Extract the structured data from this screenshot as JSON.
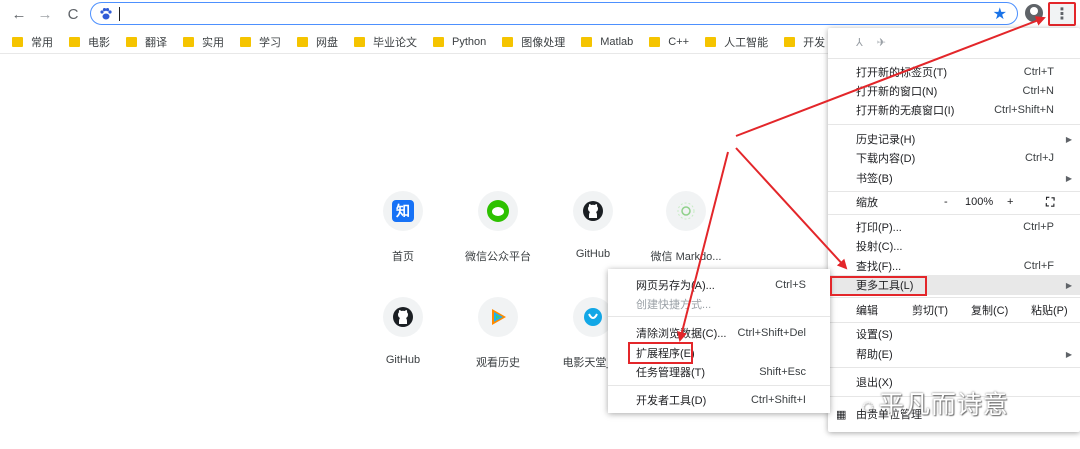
{
  "toolbar": {
    "back_icon": "arrow-left",
    "forward_icon": "arrow-right",
    "reload_icon": "reload",
    "address_value": "",
    "bookmark_star_icon": "star",
    "profile_icon": "account-circle",
    "menu_icon": "kebab-menu"
  },
  "bookmarks": [
    "常用",
    "电影",
    "翻译",
    "实用",
    "学习",
    "网盘",
    "毕业论文",
    "Python",
    "图像处理",
    "Matlab",
    "C++",
    "人工智能",
    "开发"
  ],
  "tiles": [
    {
      "label": "首页",
      "icon": "zhihu"
    },
    {
      "label": "微信公众平台",
      "icon": "wechat"
    },
    {
      "label": "GitHub",
      "icon": "github"
    },
    {
      "label": "微信 Markdo...",
      "icon": "mdnice"
    },
    {
      "label": "GitHub",
      "icon": "github"
    },
    {
      "label": "观看历史",
      "icon": "tencent-video"
    },
    {
      "label": "电影天堂_电",
      "icon": "movie"
    }
  ],
  "menu": {
    "new_tab": {
      "label": "打开新的标签页(T)",
      "shortcut": "Ctrl+T"
    },
    "new_window": {
      "label": "打开新的窗口(N)",
      "shortcut": "Ctrl+N"
    },
    "incognito": {
      "label": "打开新的无痕窗口(I)",
      "shortcut": "Ctrl+Shift+N"
    },
    "history": {
      "label": "历史记录(H)"
    },
    "downloads": {
      "label": "下载内容(D)",
      "shortcut": "Ctrl+J"
    },
    "bookmarks": {
      "label": "书签(B)"
    },
    "zoom": {
      "label": "缩放",
      "minus": "-",
      "value": "100%",
      "plus": "+"
    },
    "print": {
      "label": "打印(P)...",
      "shortcut": "Ctrl+P"
    },
    "cast": {
      "label": "投射(C)..."
    },
    "find": {
      "label": "查找(F)...",
      "shortcut": "Ctrl+F"
    },
    "more_tools": {
      "label": "更多工具(L)"
    },
    "edit": {
      "label": "编辑",
      "cut": "剪切(T)",
      "copy": "复制(C)",
      "paste": "粘贴(P)"
    },
    "settings": {
      "label": "设置(S)"
    },
    "help": {
      "label": "帮助(E)"
    },
    "exit": {
      "label": "退出(X)"
    },
    "managed": {
      "label": "由贵单位管理"
    }
  },
  "submenu": {
    "save_page": {
      "label": "网页另存为(A)...",
      "shortcut": "Ctrl+S"
    },
    "create_shortcut": {
      "label": "创建快捷方式..."
    },
    "clear_data": {
      "label": "清除浏览数据(C)...",
      "shortcut": "Ctrl+Shift+Del"
    },
    "extensions": {
      "label": "扩展程序(E)"
    },
    "task_manager": {
      "label": "任务管理器(T)",
      "shortcut": "Shift+Esc"
    },
    "dev_tools": {
      "label": "开发者工具(D)",
      "shortcut": "Ctrl+Shift+I"
    }
  },
  "watermark": "平凡而诗意",
  "colors": {
    "annotation": "#e3262a",
    "accent": "#1a73e8",
    "folder": "#f5c400"
  }
}
